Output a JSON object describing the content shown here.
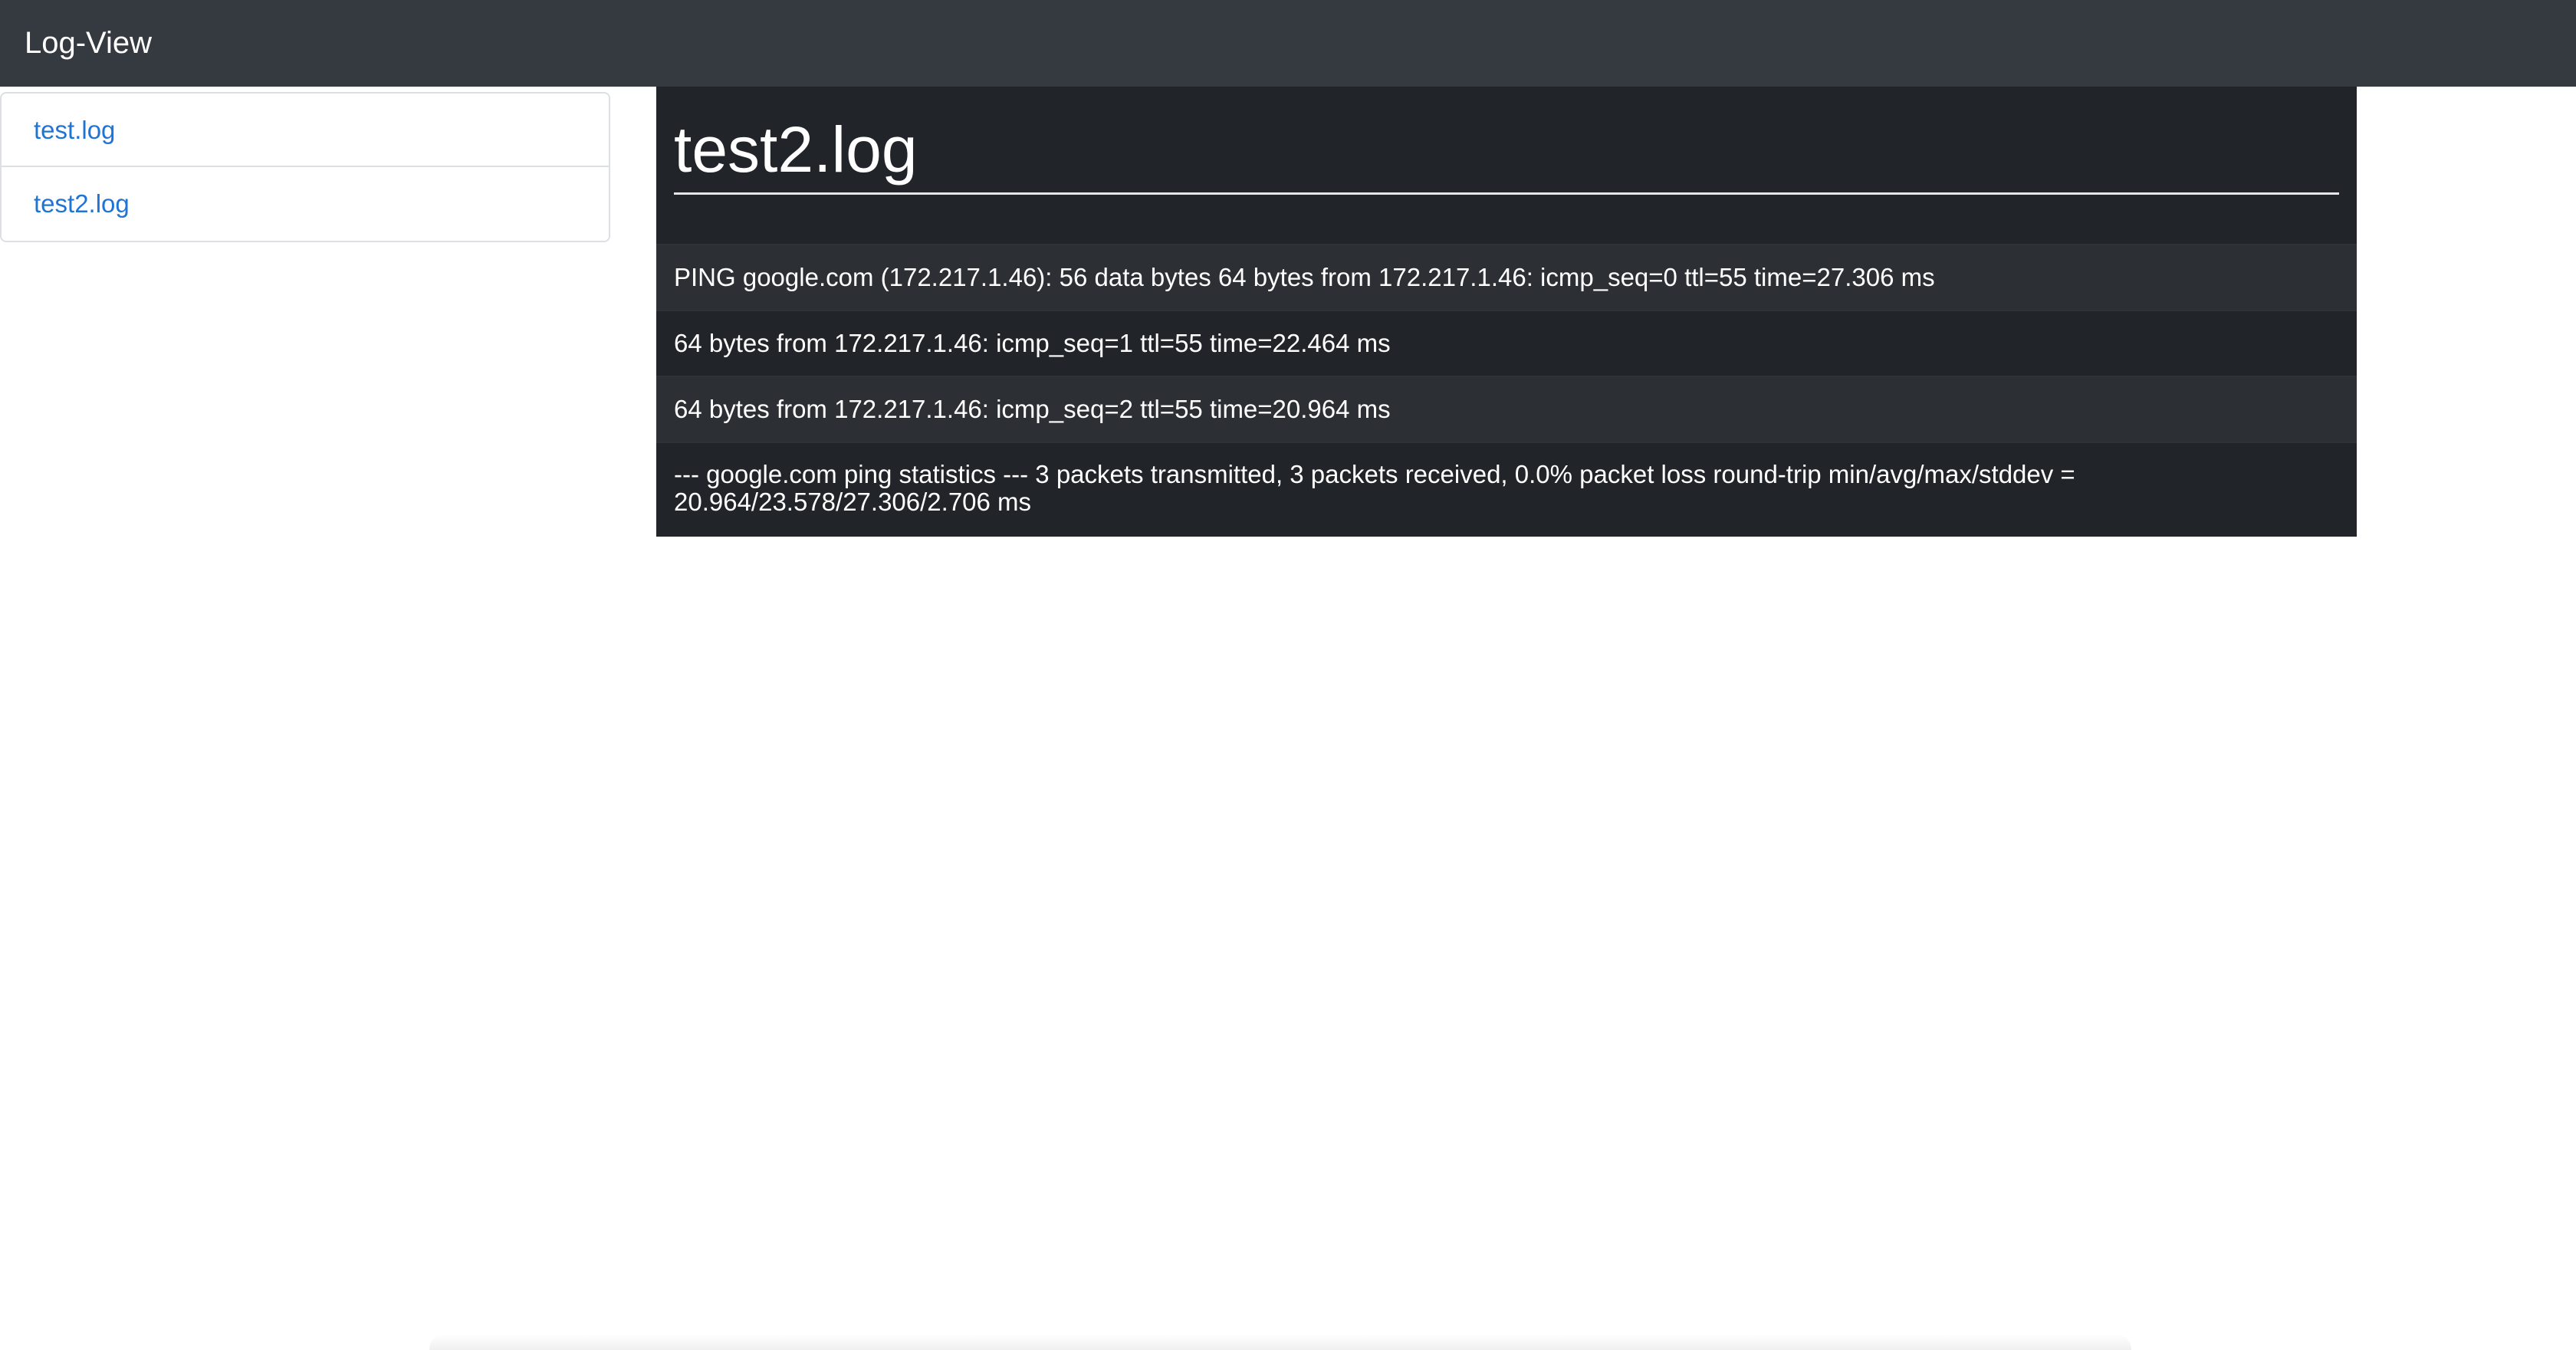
{
  "navbar": {
    "brand": "Log-View"
  },
  "sidebar": {
    "items": [
      {
        "label": "test.log"
      },
      {
        "label": "test2.log"
      }
    ]
  },
  "main": {
    "title": "test2.log",
    "rows": [
      "PING google.com (172.217.1.46): 56 data bytes 64 bytes from 172.217.1.46: icmp_seq=0 ttl=55 time=27.306 ms",
      "64 bytes from 172.217.1.46: icmp_seq=1 ttl=55 time=22.464 ms",
      "64 bytes from 172.217.1.46: icmp_seq=2 ttl=55 time=20.964 ms",
      "--- google.com ping statistics --- 3 packets transmitted, 3 packets received, 0.0% packet loss round-trip min/avg/max/stddev = 20.964/23.578/27.306/2.706 ms"
    ]
  },
  "colors": {
    "navbar_bg": "#343a40",
    "main_bg": "#212529",
    "row_stripe": "#2c3034",
    "link": "#1f74d6"
  }
}
